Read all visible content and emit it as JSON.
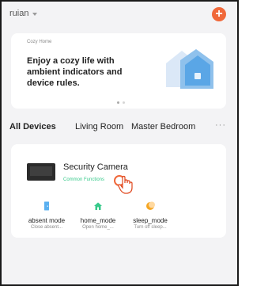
{
  "header": {
    "home_name": "ruian",
    "add_label": "+"
  },
  "banner": {
    "tag": "Cozy Home",
    "text": "Enjoy a cozy life with ambient indicators and device rules."
  },
  "tabs": [
    {
      "label": "All Devices",
      "active": true
    },
    {
      "label": "Living Room"
    },
    {
      "label": "Master Bedroom"
    }
  ],
  "more_label": "···",
  "device": {
    "name": "Security Camera",
    "function_label": "Common Functions"
  },
  "scenes": [
    {
      "name": "absent mode",
      "desc": "Close absent...",
      "icon": "door-icon",
      "color": "#5ab0f0"
    },
    {
      "name": "home_mode",
      "desc": "Open home_...",
      "icon": "home-icon",
      "color": "#36c98a"
    },
    {
      "name": "sleep_mode",
      "desc": "Turn off sleep...",
      "icon": "moon-icon",
      "color": "#f5a623"
    }
  ],
  "colors": {
    "accent": "#f0683a",
    "function_green": "#36c98a",
    "background": "#f3f3f5"
  }
}
